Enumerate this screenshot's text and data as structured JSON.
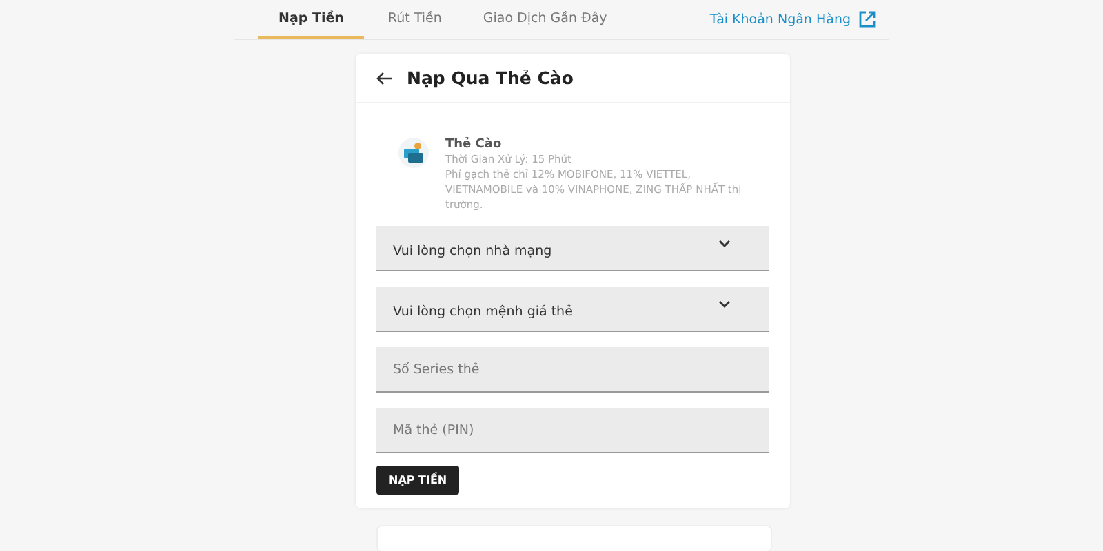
{
  "tabs": [
    {
      "label": "Nạp Tiền",
      "selected": true
    },
    {
      "label": "Rút Tiền",
      "selected": false
    },
    {
      "label": "Giao Dịch Gần Đây",
      "selected": false
    }
  ],
  "bank_link": {
    "label": "Tài Khoản Ngân Hàng"
  },
  "card": {
    "title": "Nạp Qua Thẻ Cào",
    "method": {
      "name": "Thẻ Cào",
      "processing_time": "Thời Gian Xử Lý: 15 Phút",
      "note": "Phí gạch thẻ chỉ 12% MOBIFONE, 11% VIETTEL, VIETNAMOBILE và 10% VINAPHONE, ZING THẤP NHẤT thị trường."
    },
    "fields": [
      {
        "kind": "select",
        "value": "Vui lòng chọn nhà mạng"
      },
      {
        "kind": "select",
        "value": "Vui lòng chọn mệnh giá thẻ"
      },
      {
        "kind": "input",
        "placeholder": "Số Series thẻ"
      },
      {
        "kind": "input",
        "placeholder": "Mã thẻ (PIN)"
      }
    ],
    "submit": "NẠP TIỀN"
  }
}
